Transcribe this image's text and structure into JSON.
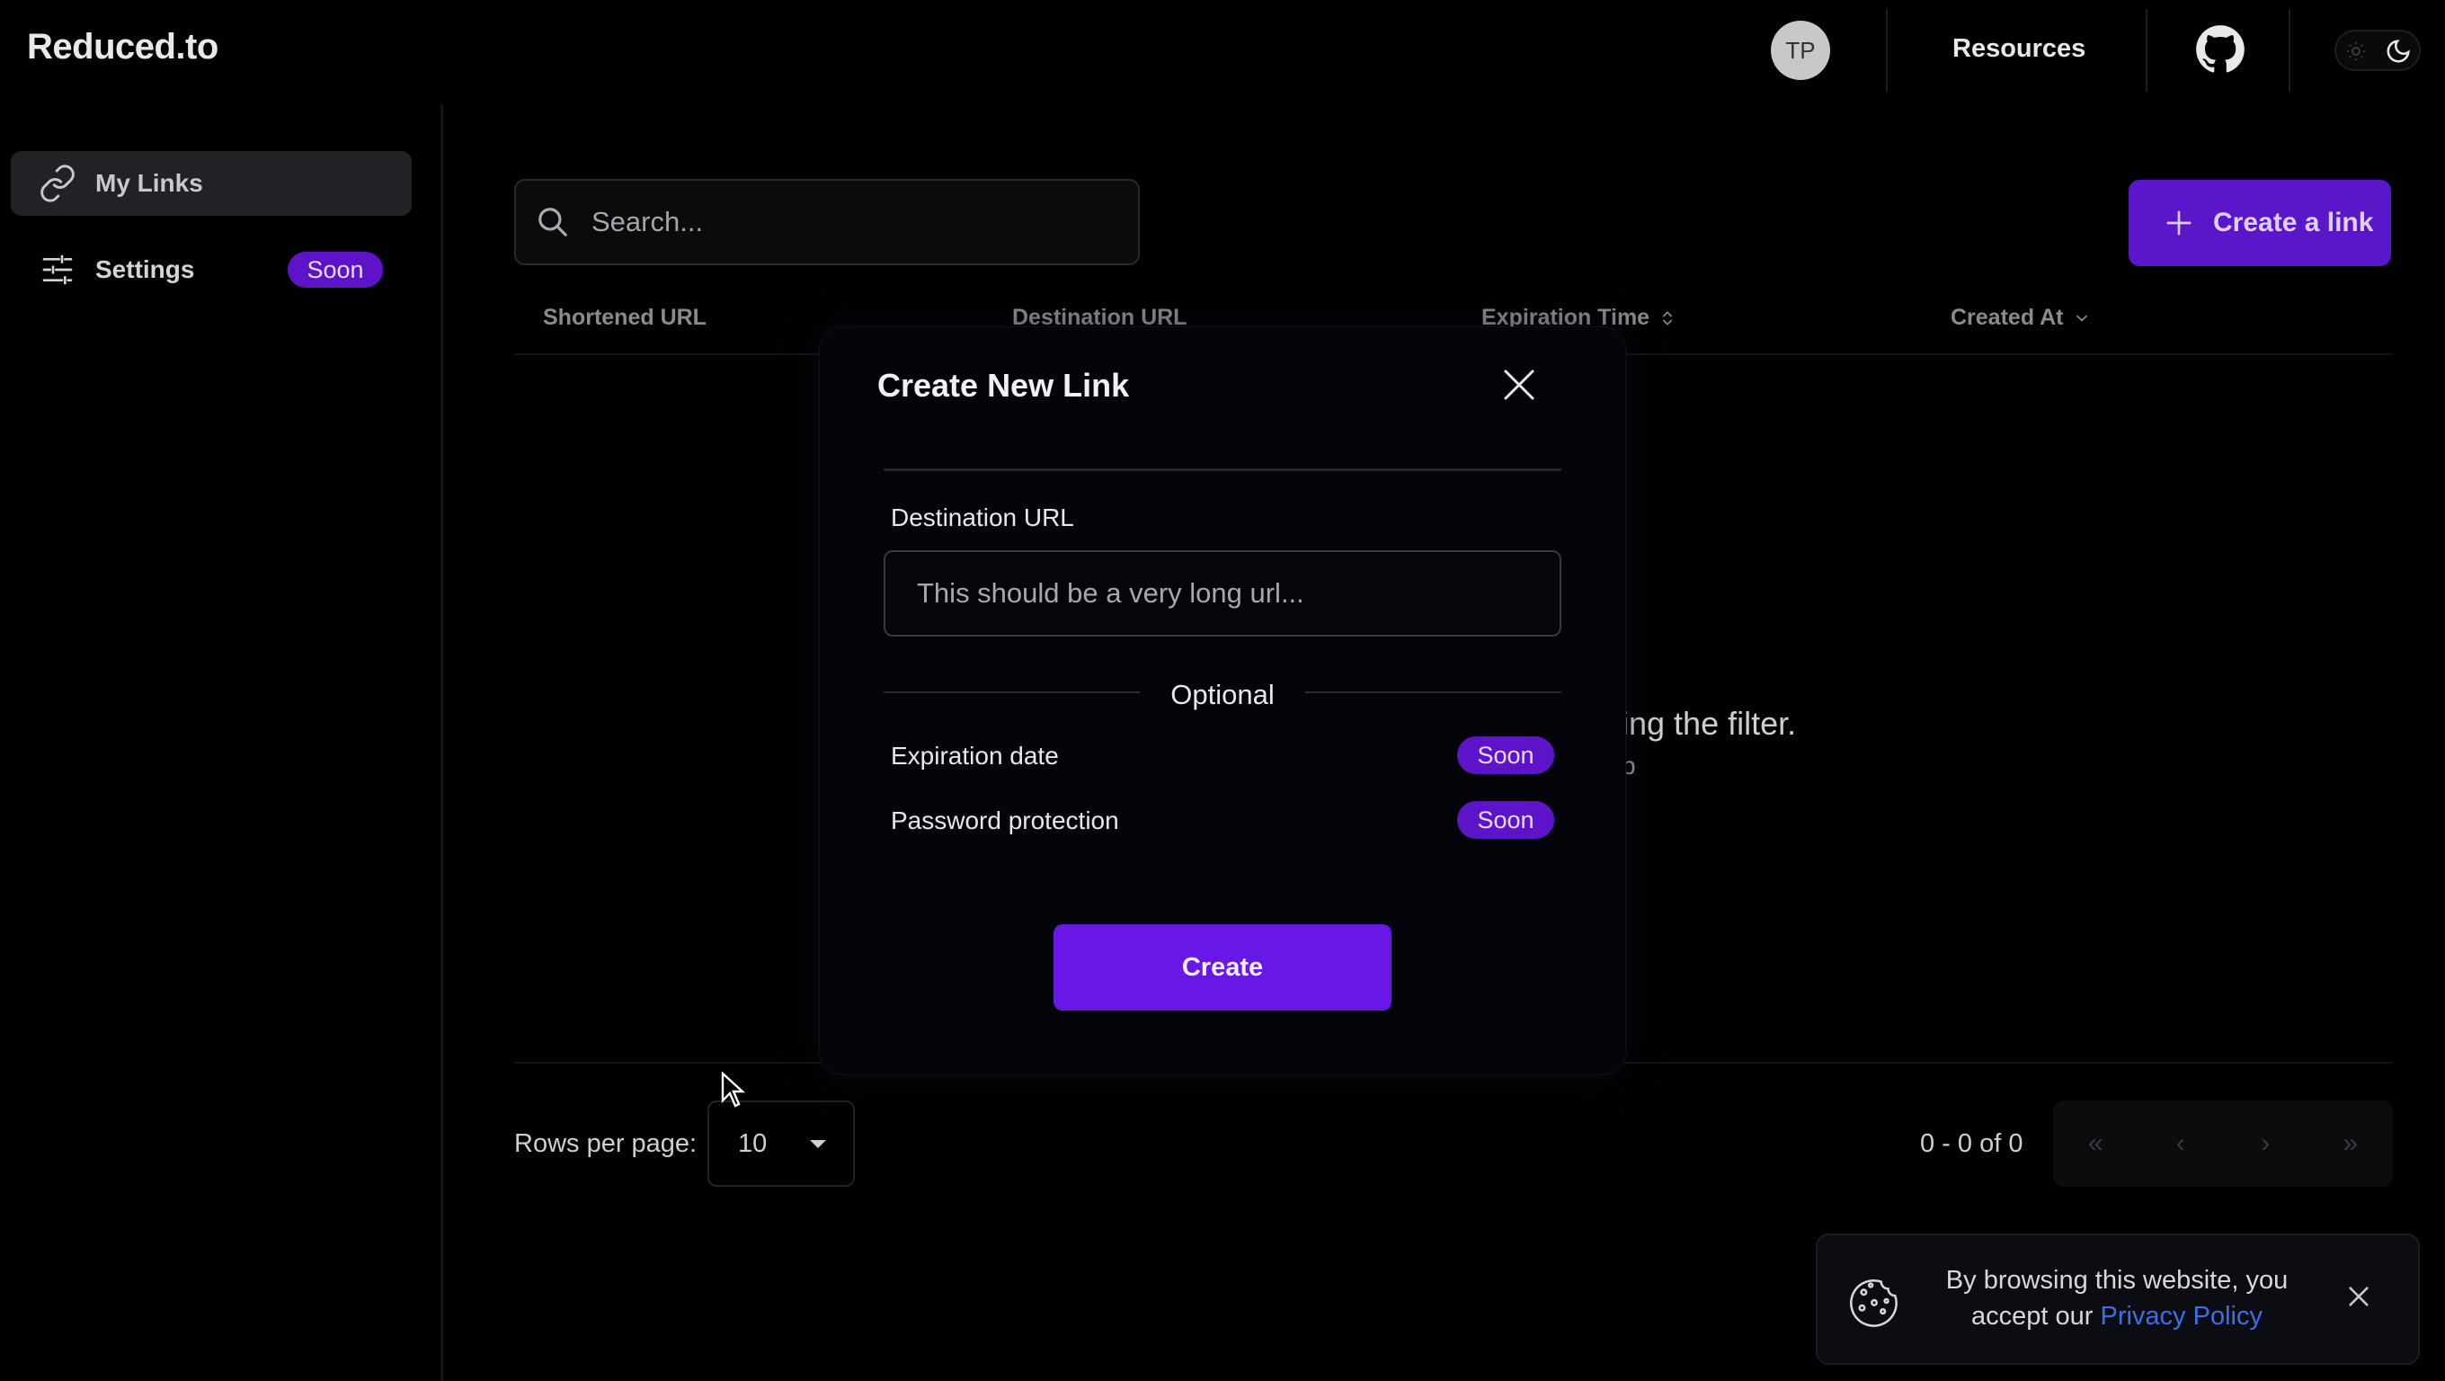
{
  "header": {
    "brand": "Reduced.to",
    "avatar_initials": "TP",
    "resources_label": "Resources",
    "github_icon": "github-icon",
    "theme_icons": [
      "sun-icon",
      "moon-icon"
    ]
  },
  "sidebar": {
    "items": [
      {
        "label": "My Links",
        "icon": "link-icon",
        "active": true
      },
      {
        "label": "Settings",
        "icon": "sliders-icon",
        "badge": "Soon"
      }
    ]
  },
  "toolbar": {
    "search_placeholder": "Search...",
    "create_link_label": "Create a link"
  },
  "table": {
    "columns": [
      "Shortened URL",
      "Destination URL",
      "Expiration Time",
      "Created At"
    ],
    "empty_text_fragment": "ing the filter.",
    "empty_subtext_fragment": "p"
  },
  "pagination": {
    "rows_per_page_label": "Rows per page:",
    "rows_per_page_value": "10",
    "range_text": "0 - 0 of 0",
    "buttons": [
      "«",
      "‹",
      "›",
      "»"
    ]
  },
  "modal": {
    "title": "Create New Link",
    "destination_label": "Destination URL",
    "destination_placeholder": "This should be a very long url...",
    "optional_label": "Optional",
    "options": [
      {
        "label": "Expiration date",
        "badge": "Soon"
      },
      {
        "label": "Password protection",
        "badge": "Soon"
      }
    ],
    "create_label": "Create"
  },
  "cookie": {
    "text_line1": "By browsing this website, you",
    "text_line2_prefix": "accept our ",
    "link_text": "Privacy Policy"
  },
  "colors": {
    "background": "#010101",
    "accent": "#6717e6",
    "badge": "#5d14c9",
    "link": "#3c6fe6"
  }
}
